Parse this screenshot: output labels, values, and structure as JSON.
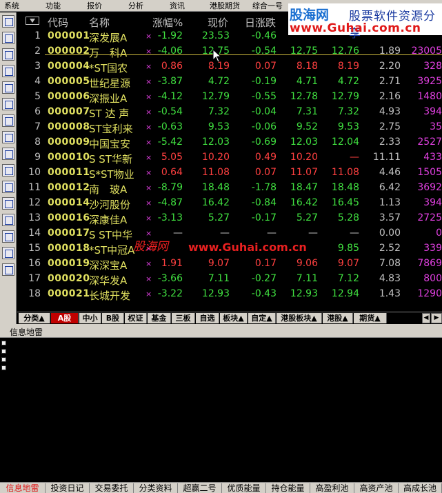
{
  "menubar": [
    "系统",
    "功能",
    "报价",
    "分析",
    "资讯",
    "港股期货",
    "综合一号"
  ],
  "logo": {
    "brand": "股海网",
    "tagline": "股票软件资源分享",
    "url": "www.Guhai.com.cn",
    "colors": {
      "brand": "#1a6fd1",
      "url": "#e01818"
    }
  },
  "watermark": {
    "brand": "股海网",
    "url": "www.Guhai.com.cn"
  },
  "grid": {
    "headers": {
      "code": "代码",
      "name": "名称",
      "pct": "涨幅%",
      "price": "现价",
      "chg": "日涨跌"
    },
    "rows": [
      {
        "idx": "1",
        "code": "000001",
        "name": "深发展A",
        "pct": "-1.92",
        "price": "23.53",
        "chg": "-0.46",
        "buy": "",
        "sell": "",
        "vol": "",
        "amt": "",
        "dir": "dn"
      },
      {
        "idx": "2",
        "code": "000002",
        "name": "万　科A",
        "pct": "-4.06",
        "price": "12.75",
        "chg": "-0.54",
        "buy": "12.75",
        "sell": "12.76",
        "vol": "1.89",
        "amt": "23005",
        "dir": "dn"
      },
      {
        "idx": "3",
        "code": "000004",
        "name": "*ST国农",
        "pct": "0.86",
        "price": "8.19",
        "chg": "0.07",
        "buy": "8.18",
        "sell": "8.19",
        "vol": "2.20",
        "amt": "328",
        "dir": "up"
      },
      {
        "idx": "4",
        "code": "000005",
        "name": "世纪星源",
        "pct": "-3.87",
        "price": "4.72",
        "chg": "-0.19",
        "buy": "4.71",
        "sell": "4.72",
        "vol": "2.71",
        "amt": "3925",
        "dir": "dn"
      },
      {
        "idx": "5",
        "code": "000006",
        "name": "深振业A",
        "pct": "-4.12",
        "price": "12.79",
        "chg": "-0.55",
        "buy": "12.78",
        "sell": "12.79",
        "vol": "2.16",
        "amt": "1480",
        "dir": "dn"
      },
      {
        "idx": "6",
        "code": "000007",
        "name": "ST 达 声",
        "pct": "-0.54",
        "price": "7.32",
        "chg": "-0.04",
        "buy": "7.31",
        "sell": "7.32",
        "vol": "4.93",
        "amt": "394",
        "dir": "dn"
      },
      {
        "idx": "7",
        "code": "000008",
        "name": "ST宝利来",
        "pct": "-0.63",
        "price": "9.53",
        "chg": "-0.06",
        "buy": "9.52",
        "sell": "9.53",
        "vol": "2.75",
        "amt": "35",
        "dir": "dn"
      },
      {
        "idx": "8",
        "code": "000009",
        "name": "中国宝安",
        "pct": "-5.42",
        "price": "12.03",
        "chg": "-0.69",
        "buy": "12.03",
        "sell": "12.04",
        "vol": "2.33",
        "amt": "2527",
        "dir": "dn"
      },
      {
        "idx": "9",
        "code": "000010",
        "name": "S ST华新",
        "pct": "5.05",
        "price": "10.20",
        "chg": "0.49",
        "buy": "10.20",
        "sell": "—",
        "vol": "11.11",
        "amt": "433",
        "dir": "up"
      },
      {
        "idx": "10",
        "code": "000011",
        "name": "S*ST物业",
        "pct": "0.64",
        "price": "11.08",
        "chg": "0.07",
        "buy": "11.07",
        "sell": "11.08",
        "vol": "4.46",
        "amt": "1505",
        "dir": "up"
      },
      {
        "idx": "11",
        "code": "000012",
        "name": "南　玻A",
        "pct": "-8.79",
        "price": "18.48",
        "chg": "-1.78",
        "buy": "18.47",
        "sell": "18.48",
        "vol": "6.42",
        "amt": "3692",
        "dir": "dn"
      },
      {
        "idx": "12",
        "code": "000014",
        "name": "沙河股份",
        "pct": "-4.87",
        "price": "16.42",
        "chg": "-0.84",
        "buy": "16.42",
        "sell": "16.45",
        "vol": "1.13",
        "amt": "394",
        "dir": "dn"
      },
      {
        "idx": "13",
        "code": "000016",
        "name": "深康佳A",
        "pct": "-3.13",
        "price": "5.27",
        "chg": "-0.17",
        "buy": "5.27",
        "sell": "5.28",
        "vol": "3.57",
        "amt": "2725",
        "dir": "dn"
      },
      {
        "idx": "14",
        "code": "000017",
        "name": "S ST中华",
        "pct": "—",
        "price": "—",
        "chg": "—",
        "buy": "—",
        "sell": "—",
        "vol": "0.00",
        "amt": "0",
        "dir": "neu"
      },
      {
        "idx": "15",
        "code": "000018",
        "name": "*ST中冠A",
        "pct": "",
        "price": "",
        "chg": "",
        "buy": "",
        "sell": "9.85",
        "vol": "2.52",
        "amt": "339",
        "dir": "dn"
      },
      {
        "idx": "16",
        "code": "000019",
        "name": "深深宝A",
        "pct": "1.91",
        "price": "9.07",
        "chg": "0.17",
        "buy": "9.06",
        "sell": "9.07",
        "vol": "7.08",
        "amt": "7869",
        "dir": "up"
      },
      {
        "idx": "17",
        "code": "000020",
        "name": "深华发A",
        "pct": "-3.66",
        "price": "7.11",
        "chg": "-0.27",
        "buy": "7.11",
        "sell": "7.12",
        "vol": "4.83",
        "amt": "800",
        "dir": "dn"
      },
      {
        "idx": "18",
        "code": "000021",
        "name": "长城开发",
        "pct": "-3.22",
        "price": "12.93",
        "chg": "-0.43",
        "buy": "12.93",
        "sell": "12.94",
        "vol": "1.43",
        "amt": "1290",
        "dir": "dn"
      }
    ]
  },
  "tabs": [
    {
      "label": "分类▲",
      "active": false
    },
    {
      "label": "A股",
      "active": true
    },
    {
      "label": "中小",
      "active": false
    },
    {
      "label": "B股",
      "active": false
    },
    {
      "label": "权证",
      "active": false
    },
    {
      "label": "基金",
      "active": false
    },
    {
      "label": "三板",
      "active": false
    },
    {
      "label": "自选",
      "active": false
    },
    {
      "label": "板块▲",
      "active": false
    },
    {
      "label": "自定▲",
      "active": false
    },
    {
      "label": "港股板块▲",
      "active": false
    },
    {
      "label": "港股▲",
      "active": false
    },
    {
      "label": "期货▲",
      "active": false
    }
  ],
  "info_panel": {
    "title": "信息地雷"
  },
  "bottom_tabs": [
    {
      "label": "信息地雷",
      "active": true
    },
    {
      "label": "投资日记",
      "active": false
    },
    {
      "label": "交易委托",
      "active": false
    },
    {
      "label": "分类资料",
      "active": false
    },
    {
      "label": "超赢二号",
      "active": false
    },
    {
      "label": "优质能量",
      "active": false
    },
    {
      "label": "持仓能量",
      "active": false
    },
    {
      "label": "高盈利池",
      "active": false
    },
    {
      "label": "高资产池",
      "active": false
    },
    {
      "label": "高成长池",
      "active": false
    }
  ],
  "colors": {
    "up": "#ff4040",
    "down": "#40e040",
    "code": "#e0e060",
    "amount": "#e040e0"
  }
}
